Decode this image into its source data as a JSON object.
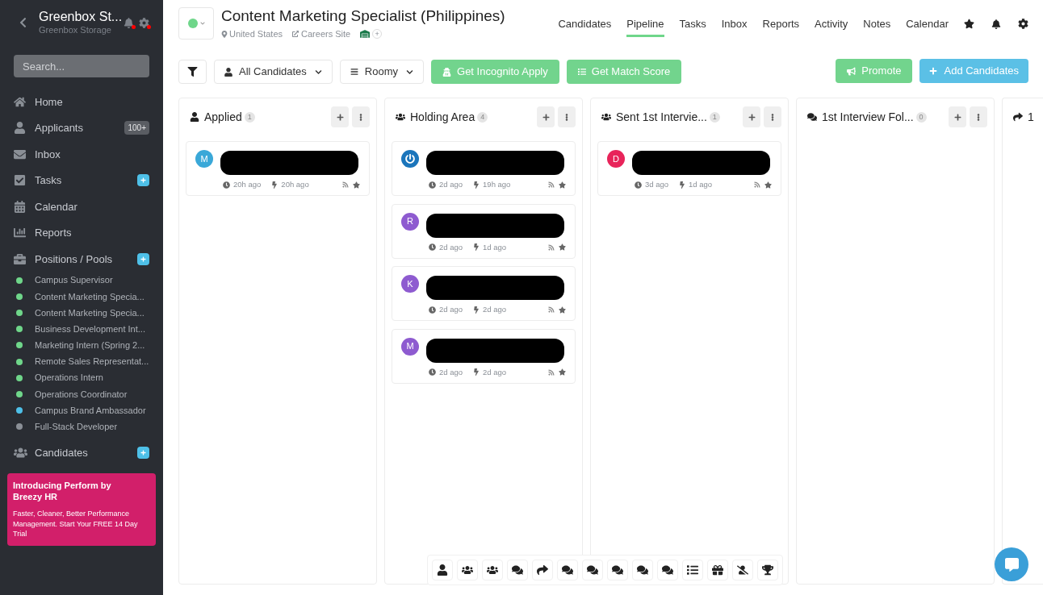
{
  "sidebar": {
    "company": "Greenbox St...",
    "company_subtitle": "Greenbox Storage",
    "search": {
      "placeholder": "Search..."
    },
    "nav": [
      {
        "label": "Home",
        "kind": "home"
      },
      {
        "label": "Applicants",
        "kind": "user",
        "badge": "100+"
      },
      {
        "label": "Inbox",
        "kind": "mail"
      },
      {
        "label": "Tasks",
        "kind": "tasks",
        "add": true
      },
      {
        "label": "Calendar",
        "kind": "calendar"
      },
      {
        "label": "Reports",
        "kind": "reports"
      },
      {
        "label": "Positions / Pools",
        "kind": "briefcase",
        "add": true
      }
    ],
    "positions": [
      {
        "label": "Campus Supervisor",
        "color": "#6fd68a"
      },
      {
        "label": "Content Marketing Specia...",
        "color": "#6fd68a"
      },
      {
        "label": "Content Marketing Specia...",
        "color": "#6fd68a"
      },
      {
        "label": "Business Development Int...",
        "color": "#6fd68a"
      },
      {
        "label": "Marketing Intern (Spring 2...",
        "color": "#6fd68a"
      },
      {
        "label": "Remote Sales Representat...",
        "color": "#6fd68a"
      },
      {
        "label": "Operations Intern",
        "color": "#6fd68a"
      },
      {
        "label": "Operations Coordinator",
        "color": "#6fd68a"
      },
      {
        "label": "Campus Brand Ambassador",
        "color": "#4ec0e8"
      },
      {
        "label": "Full-Stack Developer",
        "color": "#8a8f96"
      }
    ],
    "candidates": {
      "label": "Candidates",
      "add": true
    },
    "promo": {
      "title": "Introducing Perform by Breezy HR",
      "text": "Faster, Cleaner, Better Performance Management. Start Your FREE 14 Day Trial"
    }
  },
  "header": {
    "title": "Content Marketing Specialist (Philippines)",
    "location": "United States",
    "link": "Careers Site",
    "plus": "+",
    "tabs": [
      {
        "label": "Candidates",
        "selected": false
      },
      {
        "label": "Pipeline",
        "selected": true
      },
      {
        "label": "Tasks",
        "selected": false
      },
      {
        "label": "Inbox",
        "selected": false
      },
      {
        "label": "Reports",
        "selected": false
      },
      {
        "label": "Activity",
        "selected": false
      },
      {
        "label": "Notes",
        "selected": false
      },
      {
        "label": "Calendar",
        "selected": false
      }
    ]
  },
  "toolbar": {
    "filter": "All Candidates",
    "view": "Roomy",
    "incognito": "Get Incognito Apply",
    "match": "Get Match Score",
    "promote": "Promote",
    "add": "Add Candidates"
  },
  "columns": [
    {
      "kind": "user",
      "title": "Applied",
      "count": "1",
      "cards": [
        {
          "avatar": {
            "kind": "letter",
            "letter": "M",
            "color": "#3aa8d8"
          },
          "created": "20h ago",
          "activity": "20h ago"
        }
      ]
    },
    {
      "kind": "users",
      "title": "Holding Area",
      "count": "4",
      "cards": [
        {
          "avatar": {
            "kind": "logo",
            "color": "#1b75bb"
          },
          "created": "2d ago",
          "activity": "19h ago"
        },
        {
          "avatar": {
            "kind": "letter",
            "letter": "R",
            "color": "#8e5bd0"
          },
          "created": "2d ago",
          "activity": "1d ago"
        },
        {
          "avatar": {
            "kind": "letter",
            "letter": "K",
            "color": "#8e5bd0"
          },
          "created": "2d ago",
          "activity": "2d ago"
        },
        {
          "avatar": {
            "kind": "letter",
            "letter": "M",
            "color": "#8e5bd0"
          },
          "created": "2d ago",
          "activity": "2d ago"
        }
      ]
    },
    {
      "kind": "users",
      "title": "Sent 1st Intervie...",
      "count": "1",
      "cards": [
        {
          "avatar": {
            "kind": "letter",
            "letter": "D",
            "color": "#e8245a"
          },
          "created": "3d ago",
          "activity": "1d ago"
        }
      ]
    },
    {
      "kind": "comments",
      "title": "1st Interview Fol...",
      "count": "0"
    },
    {
      "kind": "share",
      "title": "1"
    }
  ],
  "stage_bar": [
    {
      "kind": "user"
    },
    {
      "kind": "users"
    },
    {
      "kind": "users"
    },
    {
      "kind": "comments"
    },
    {
      "kind": "share"
    },
    {
      "kind": "comments"
    },
    {
      "kind": "comments"
    },
    {
      "kind": "comments"
    },
    {
      "kind": "comments"
    },
    {
      "kind": "comments"
    },
    {
      "kind": "list"
    },
    {
      "kind": "gift"
    },
    {
      "kind": "user-slash"
    },
    {
      "kind": "trophy"
    }
  ]
}
